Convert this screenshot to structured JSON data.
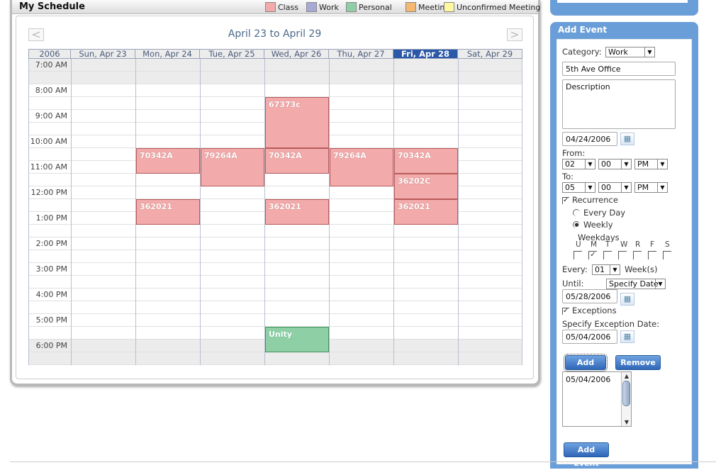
{
  "schedule": {
    "title": "My Schedule",
    "legend": [
      {
        "label": "Class",
        "color": "#f2aaaa"
      },
      {
        "label": "Work",
        "color": "#a9a9d8"
      },
      {
        "label": "Personal",
        "color": "#8fcfa6"
      },
      {
        "label": "Meeting",
        "color": "#f5b870"
      },
      {
        "label": "Unconfirmed Meeting",
        "color": "#fff8a0"
      }
    ],
    "prev": "<",
    "next": ">",
    "range": "April 23 to April 29",
    "year": "2006",
    "days": [
      "Sun, Apr 23",
      "Mon, Apr 24",
      "Tue, Apr 25",
      "Wed, Apr 26",
      "Thu, Apr 27",
      "Fri, Apr 28",
      "Sat, Apr 29"
    ],
    "today_index": 5,
    "hours": [
      "7:00 AM",
      "8:00 AM",
      "9:00 AM",
      "10:00 AM",
      "11:00 AM",
      "12:00 PM",
      "1:00 PM",
      "2:00 PM",
      "3:00 PM",
      "4:00 PM",
      "5:00 PM",
      "6:00 PM"
    ],
    "events": [
      {
        "label": "67373c",
        "day": 3,
        "start": 8.5,
        "end": 10.5,
        "kind": "class"
      },
      {
        "label": "70342A",
        "day": 1,
        "start": 10.5,
        "end": 11.5,
        "kind": "class"
      },
      {
        "label": "79264A",
        "day": 2,
        "start": 10.5,
        "end": 12,
        "kind": "class"
      },
      {
        "label": "70342A",
        "day": 3,
        "start": 10.5,
        "end": 11.5,
        "kind": "class"
      },
      {
        "label": "79264A",
        "day": 4,
        "start": 10.5,
        "end": 12,
        "kind": "class"
      },
      {
        "label": "70342A",
        "day": 5,
        "start": 10.5,
        "end": 11.5,
        "kind": "class"
      },
      {
        "label": "36202C",
        "day": 5,
        "start": 11.5,
        "end": 12.5,
        "kind": "class"
      },
      {
        "label": "362021",
        "day": 1,
        "start": 12.5,
        "end": 13.5,
        "kind": "class"
      },
      {
        "label": "362021",
        "day": 3,
        "start": 12.5,
        "end": 13.5,
        "kind": "class"
      },
      {
        "label": "362021",
        "day": 5,
        "start": 12.5,
        "end": 13.5,
        "kind": "class"
      },
      {
        "label": "Unity",
        "day": 3,
        "start": 17.5,
        "end": 18.5,
        "kind": "personal"
      }
    ]
  },
  "add_event": {
    "title": "Add Event",
    "category_label": "Category:",
    "category_value": "Work",
    "location_value": "5th Ave Office",
    "description_placeholder": "Description",
    "date_value": "04/24/2006",
    "from_label": "From:",
    "from_hour": "02",
    "from_min": "00",
    "from_ampm": "PM",
    "to_label": "To:",
    "to_hour": "05",
    "to_min": "00",
    "to_ampm": "PM",
    "recurrence_label": "Recurrence",
    "every_day_label": "Every Day",
    "weekly_label": "Weekly",
    "weekdays_label": "Weekdays",
    "weekday_letters": [
      "U",
      "M",
      "T",
      "W",
      "R",
      "F",
      "S"
    ],
    "weekday_checked": [
      false,
      true,
      false,
      false,
      false,
      false,
      false
    ],
    "every_label": "Every:",
    "every_value": "01",
    "weeks_label": "Week(s)",
    "until_label": "Until:",
    "until_value": "Specify Date",
    "until_date": "05/28/2006",
    "exceptions_label": "Exceptions",
    "exception_date_label": "Specify Exception Date:",
    "exception_date": "05/04/2006",
    "add_button": "Add",
    "remove_button": "Remove",
    "exception_list": [
      "05/04/2006"
    ],
    "add_event_button": "Add Event"
  }
}
